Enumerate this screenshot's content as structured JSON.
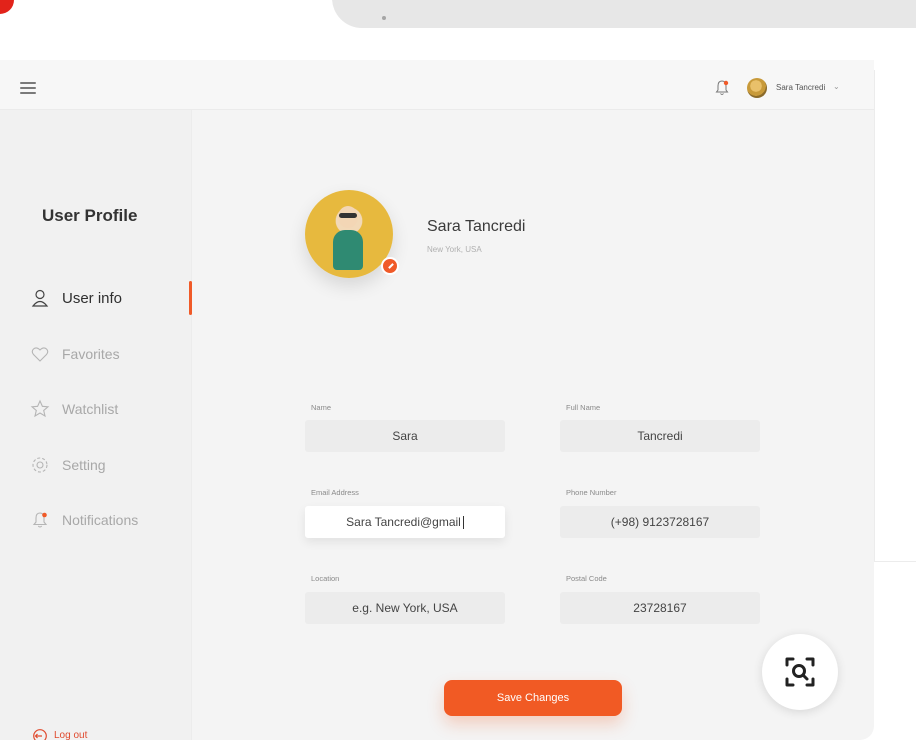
{
  "app": {
    "user_name_short": "Sara Tancredi",
    "sidebar_title": "User Profile",
    "nav": [
      {
        "label": "User info",
        "active": true,
        "icon": "user-icon"
      },
      {
        "label": "Favorites",
        "active": false,
        "icon": "heart-icon"
      },
      {
        "label": "Watchlist",
        "active": false,
        "icon": "star-icon"
      },
      {
        "label": "Setting",
        "active": false,
        "icon": "gear-icon"
      },
      {
        "label": "Notifications",
        "active": false,
        "icon": "bell-icon"
      }
    ],
    "logout_label": "Log out"
  },
  "profile": {
    "name": "Sara Tancredi",
    "location": "New York, USA"
  },
  "form": {
    "name_label": "Name",
    "name_value": "Sara",
    "fullname_label": "Full Name",
    "fullname_value": "Tancredi",
    "email_label": "Email Address",
    "email_value": "Sara Tancredi@gmail",
    "phone_label": "Phone Number",
    "phone_value": "(+98) 9123728167",
    "location_label": "Location",
    "location_value": "e.g. New York, USA",
    "postal_label": "Postal Code",
    "postal_value": "23728167",
    "save_label": "Save Changes"
  },
  "colors": {
    "accent": "#f15a24",
    "brand_red": "#e2231a"
  }
}
